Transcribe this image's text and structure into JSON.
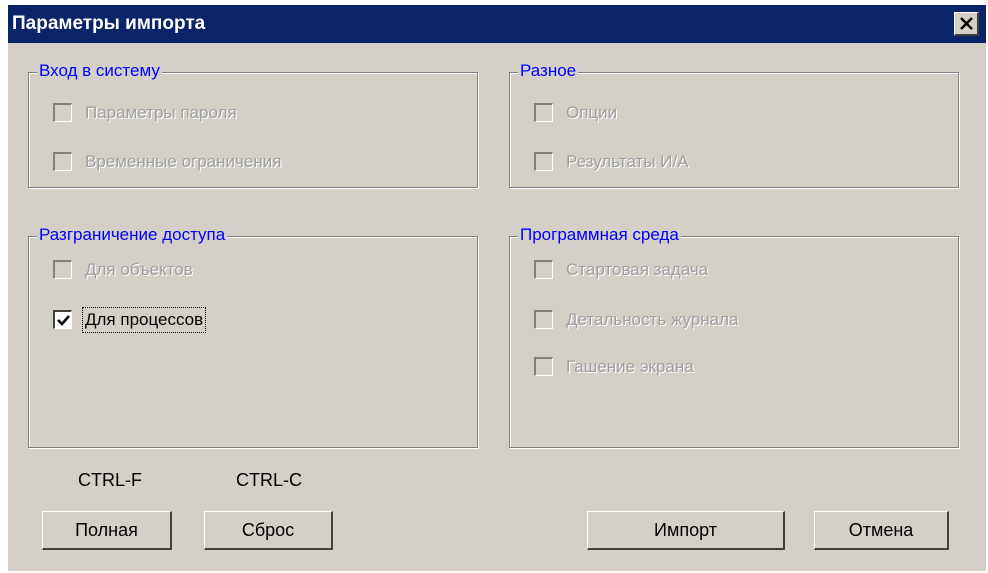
{
  "window": {
    "title": "Параметры импорта",
    "close_icon": "close-icon"
  },
  "groups": {
    "login": {
      "label": "Вход в систему",
      "items": [
        {
          "label": "Параметры пароля",
          "checked": false,
          "enabled": false
        },
        {
          "label": "Временные ограничения",
          "checked": false,
          "enabled": false
        }
      ]
    },
    "misc": {
      "label": "Разное",
      "items": [
        {
          "label": "Опции",
          "checked": false,
          "enabled": false
        },
        {
          "label": "Результаты И/А",
          "checked": false,
          "enabled": false
        }
      ]
    },
    "access": {
      "label": "Разграничение доступа",
      "items": [
        {
          "label": "Для объектов",
          "checked": false,
          "enabled": false
        },
        {
          "label": "Для процессов",
          "checked": true,
          "enabled": true
        }
      ]
    },
    "env": {
      "label": "Программная среда",
      "items": [
        {
          "label": "Стартовая задача",
          "checked": false,
          "enabled": false
        },
        {
          "label": "Детальность журнала",
          "checked": false,
          "enabled": false
        },
        {
          "label": "Гашение экрана",
          "checked": false,
          "enabled": false
        }
      ]
    }
  },
  "shortcuts": {
    "full": "CTRL-F",
    "reset": "CTRL-C"
  },
  "buttons": {
    "full": "Полная",
    "reset": "Сброс",
    "import": "Импорт",
    "cancel": "Отмена"
  },
  "colors": {
    "title_bar": "#0a246a",
    "face": "#d4d0c8",
    "group_label": "#0000ff",
    "disabled_text": "#a0a0a0"
  }
}
